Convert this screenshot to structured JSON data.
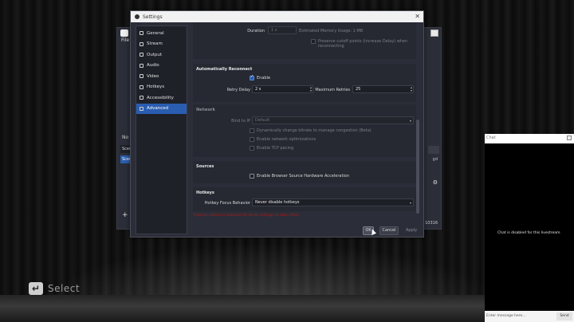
{
  "stage": {
    "select_hint": {
      "key": "↵",
      "label": "Select"
    }
  },
  "obs_main": {
    "menu_file": "File",
    "no_source": "No s",
    "scenes_header": "Scen",
    "scene_selected": "Scer",
    "add": "+",
    "rt_label": "gd",
    "gear": "⚙",
    "counter": "10316"
  },
  "settings": {
    "title": "Settings",
    "close": "✕",
    "nav": [
      {
        "label": "General",
        "active": false
      },
      {
        "label": "Stream",
        "active": false
      },
      {
        "label": "Output",
        "active": false
      },
      {
        "label": "Audio",
        "active": false
      },
      {
        "label": "Video",
        "active": false
      },
      {
        "label": "Hotkeys",
        "active": false
      },
      {
        "label": "Accessibility",
        "active": false
      },
      {
        "label": "Advanced",
        "active": true
      }
    ],
    "top": {
      "duration_label": "Duration",
      "duration_value": "1 s",
      "memory_usage": "Estimated Memory Usage: 1 MB",
      "preserve_cutoff": "Preserve cutoff points (increase Delay) when reconnecting"
    },
    "auto_reconnect": {
      "title": "Automatically Reconnect",
      "enable_label": "Enable",
      "enable_checked": true,
      "retry_delay_label": "Retry Delay",
      "retry_delay_value": "2 s",
      "max_retries_label": "Maximum Retries",
      "max_retries_value": "25"
    },
    "network": {
      "title": "Network",
      "bind_ip_label": "Bind to IP",
      "bind_ip_value": "Default",
      "dynamic_bitrate": "Dynamically change bitrate to manage congestion (Beta)",
      "network_opt": "Enable network optimizations",
      "tcp_pacing": "Enable TCP pacing"
    },
    "sources": {
      "title": "Sources",
      "browser_accel": "Enable Browser Source Hardware Acceleration"
    },
    "hotkeys": {
      "title": "Hotkeys",
      "focus_label": "Hotkey Focus Behavior",
      "focus_value": "Never disable hotkeys"
    },
    "warning": "Program restart is required for these settings to take effect.",
    "buttons": {
      "ok": "OK",
      "cancel": "Cancel",
      "apply": "Apply"
    }
  },
  "chat": {
    "title": "Chat",
    "disabled_msg": "Chat is disabled for this livestream.",
    "input_placeholder": "Enter message here...",
    "send": "Send"
  }
}
